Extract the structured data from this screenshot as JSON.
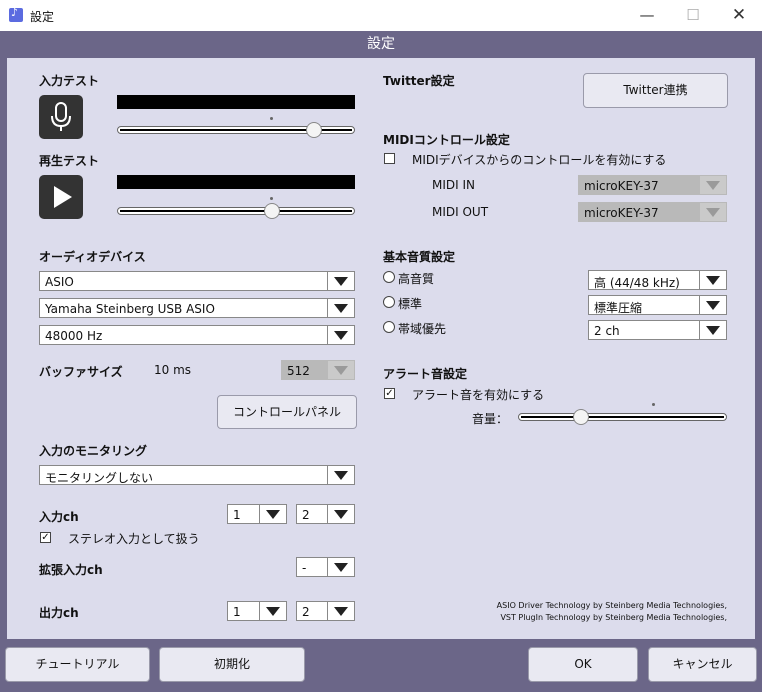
{
  "window": {
    "title": "設定"
  },
  "banner": {
    "title": "設定"
  },
  "input_test": {
    "label": "入力テスト",
    "level": 0.0,
    "volume": 0.85
  },
  "playback_test": {
    "label": "再生テスト",
    "level": 0.0,
    "volume": 0.65
  },
  "audio_device": {
    "label": "オーディオデバイス",
    "driver": "ASIO",
    "device": "Yamaha Steinberg USB ASIO",
    "sample_rate": "48000 Hz",
    "buffer_label": "バッファサイズ",
    "buffer_ms": "10 ms",
    "buffer_samples": "512",
    "control_panel": "コントロールパネル"
  },
  "monitoring": {
    "label": "入力のモニタリング",
    "value": "モニタリングしない"
  },
  "input_ch": {
    "label": "入力ch",
    "left": "1",
    "right": "2",
    "stereo_label": "ステレオ入力として扱う",
    "stereo_checked": "✓"
  },
  "ext_input": {
    "label": "拡張入力ch",
    "value": "-"
  },
  "output_ch": {
    "label": "出力ch",
    "left": "1",
    "right": "2"
  },
  "twitter": {
    "label": "Twitter設定",
    "button": "Twitter連携"
  },
  "midi": {
    "label": "MIDIコントロール設定",
    "enable_label": "MIDIデバイスからのコントロールを有効にする",
    "in_label": "MIDI IN",
    "in_value": "microKEY-37",
    "out_label": "MIDI OUT",
    "out_value": "microKEY-37"
  },
  "quality": {
    "label": "基本音質設定",
    "options": [
      "高音質",
      "標準",
      "帯域優先"
    ],
    "rate": "高 (44/48 kHz)",
    "compression": "標準圧縮",
    "channels": "2 ch"
  },
  "alert": {
    "label": "アラート音設定",
    "enable_label": "アラート音を有効にする",
    "enable_checked": "✓",
    "volume_label": "音量：",
    "volume": 0.3
  },
  "credits": {
    "line1": "ASIO Driver Technology by Steinberg Media Technologies,",
    "line2": "VST PlugIn Technology by Steinberg Media Technologies,"
  },
  "footer": {
    "tutorial": "チュートリアル",
    "reset": "初期化",
    "ok": "OK",
    "cancel": "キャンセル"
  }
}
